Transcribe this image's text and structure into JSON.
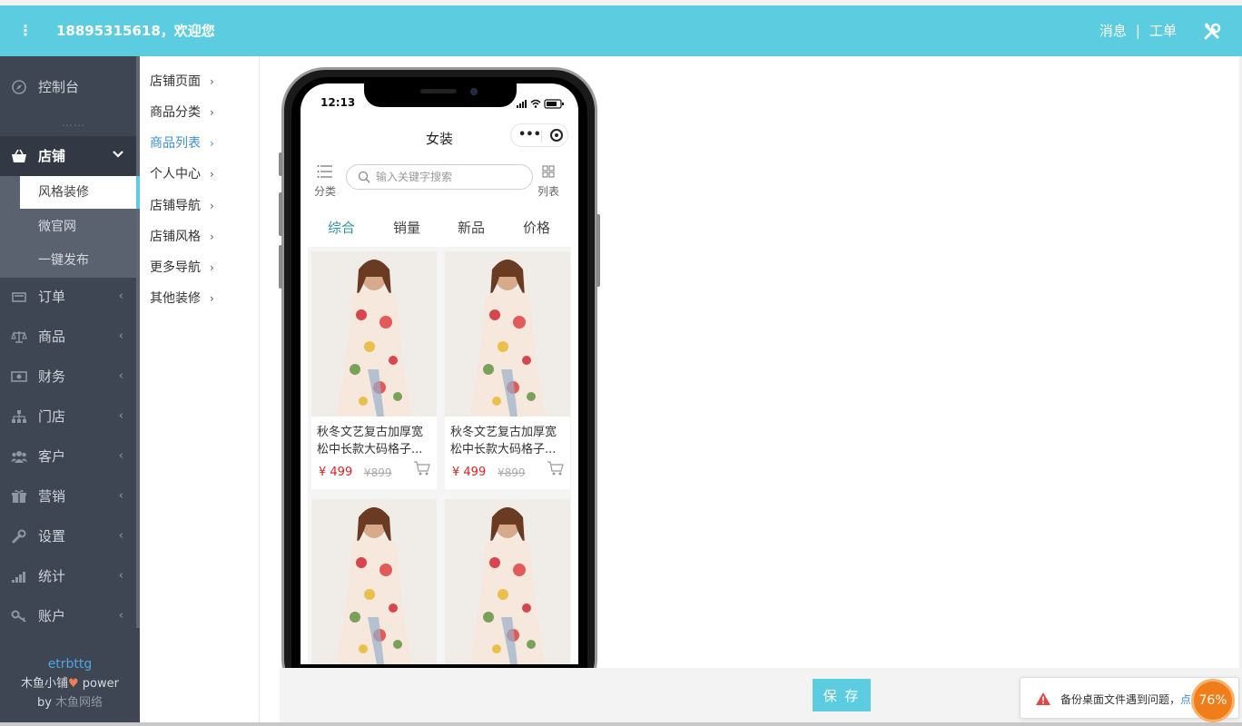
{
  "header": {
    "menu_icon": "more-vertical-icon",
    "welcome": "18895315618，欢迎您",
    "messages": "消息",
    "separator": "|",
    "tickets": "工单",
    "tools_icon": "tools-icon"
  },
  "sidebar": {
    "dashboard": "控制台",
    "dash_sep": "……",
    "store": "店铺",
    "store_sub": [
      "风格装修",
      "微官网",
      "一键发布"
    ],
    "items": [
      "订单",
      "商品",
      "财务",
      "门店",
      "客户",
      "营销",
      "设置",
      "统计",
      "账户"
    ],
    "footer_user": "etrbttg",
    "footer_power_pre": "木鱼小铺",
    "footer_power_post": " power",
    "footer_by": "by ",
    "footer_company": "木鱼网络"
  },
  "submenu": {
    "items": [
      "店铺页面",
      "商品分类",
      "商品列表",
      "个人中心",
      "店铺导航",
      "店铺风格",
      "更多导航",
      "其他装修"
    ],
    "active": "商品列表"
  },
  "phone": {
    "time": "12:13",
    "title": "女装",
    "category_label": "分类",
    "list_label": "列表",
    "search_placeholder": "输入关键字搜索",
    "sort_tabs": [
      "综合",
      "销量",
      "新品",
      "价格"
    ],
    "products": [
      {
        "name": "秋冬文艺复古加厚宽松中长款大码格子...",
        "price": "¥ 499",
        "orig": "¥899"
      },
      {
        "name": "秋冬文艺复古加厚宽松中长款大码格子...",
        "price": "¥ 499",
        "orig": "¥899"
      },
      {
        "name": "",
        "price": "",
        "orig": ""
      },
      {
        "name": "",
        "price": "",
        "orig": ""
      }
    ]
  },
  "savebar": {
    "save": "保 存"
  },
  "toast": {
    "message": "备份桌面文件遇到问题，",
    "link": "点"
  },
  "badge": "76%",
  "colors": {
    "accent": "#5ccde0",
    "sidebar": "#3f4653",
    "price": "#e02020",
    "active_tab": "#2f93a6"
  }
}
